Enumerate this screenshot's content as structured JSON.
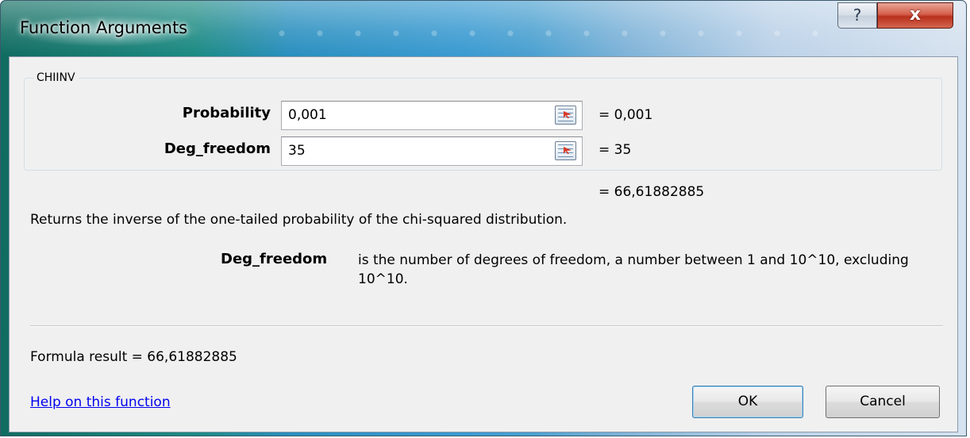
{
  "window": {
    "title": "Function Arguments",
    "help_glyph": "?",
    "close_glyph": "x"
  },
  "function": {
    "name": "CHIINV",
    "args": [
      {
        "label": "Probability",
        "input": "0,001",
        "value": "= 0,001"
      },
      {
        "label": "Deg_freedom",
        "input": "35",
        "value": "= 35"
      }
    ],
    "result_value": "= 66,61882885",
    "description": "Returns the inverse of the one-tailed probability of the chi-squared distribution.",
    "param_name": "Deg_freedom",
    "param_description": "is the number of degrees of freedom, a number between 1 and 10^10, excluding 10^10."
  },
  "footer": {
    "formula_result": "Formula result =   66,61882885",
    "help_link": "Help on this function",
    "ok_label": "OK",
    "cancel_label": "Cancel"
  },
  "icons": {
    "help": "question-mark-icon",
    "close": "close-icon",
    "ref": "range-select-icon"
  }
}
